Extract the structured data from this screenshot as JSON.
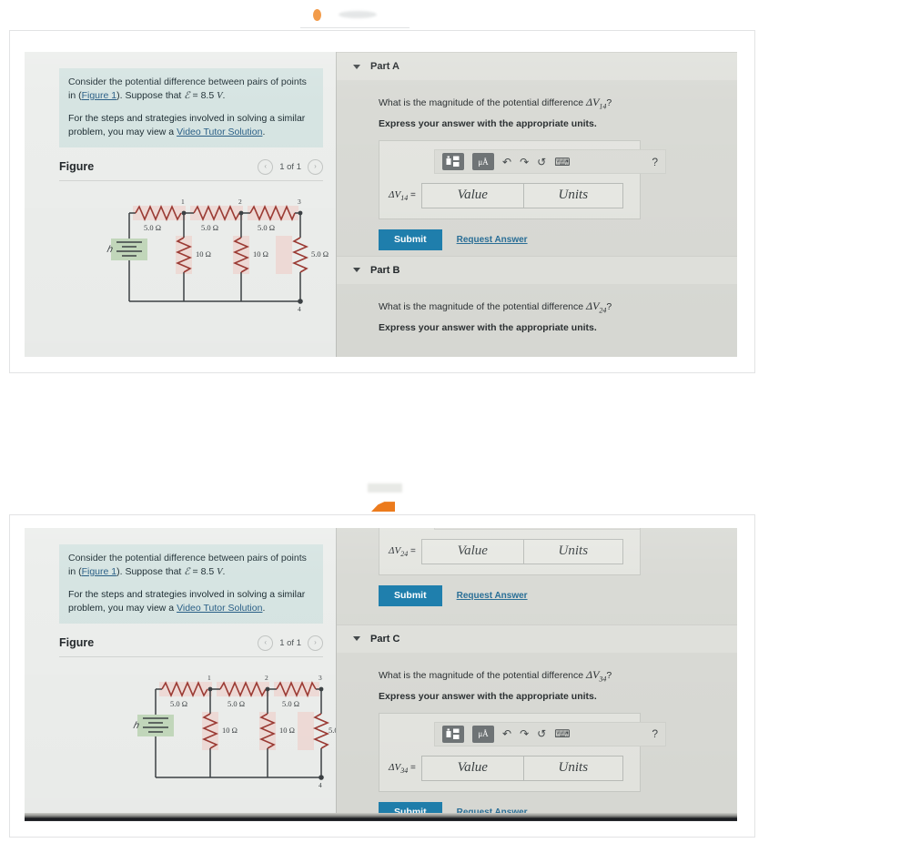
{
  "problem": {
    "para1_a": "Consider the potential difference between pairs of points in (",
    "figure_link": "Figure 1",
    "para1_b": "). Suppose that ",
    "emf_symbol": "ℰ",
    "emf_eq": " = 8.5",
    "emf_unit": "V",
    "para1_c": ".",
    "para2_a": "For the steps and strategies involved in solving a similar problem, you may view a ",
    "video_link": "Video Tutor Solution",
    "para2_b": "."
  },
  "figure": {
    "title": "Figure",
    "prev_icon": "‹",
    "next_icon": "›",
    "counter": "1 of 1"
  },
  "circuit": {
    "emf_label": "ℰ",
    "series_resistors": [
      "5.0 Ω",
      "5.0 Ω",
      "5.0 Ω"
    ],
    "shunt_resistors": [
      "10 Ω",
      "10 Ω",
      "5.0 Ω"
    ],
    "node_labels": [
      "1",
      "2",
      "3",
      "4"
    ]
  },
  "toolbar": {
    "template_icon": "template-icon",
    "units_icon": "μÅ",
    "undo_icon": "↶",
    "redo_icon": "↷",
    "reset_icon": "↺",
    "keyboard_icon": "⌨",
    "help_icon": "?"
  },
  "answer": {
    "value_placeholder": "Value",
    "units_placeholder": "Units",
    "submit_label": "Submit",
    "request_label": "Request Answer"
  },
  "parts": {
    "a": {
      "label": "Part A",
      "question_pre": "What is the magnitude of the potential difference ",
      "symbol": "ΔV",
      "subscript": "14",
      "question_post": "?",
      "instruction": "Express your answer with the appropriate units.",
      "answer_label_symbol": "ΔV",
      "answer_label_sub": "14",
      "answer_label_eq": " ="
    },
    "b": {
      "label": "Part B",
      "question_pre": "What is the magnitude of the potential difference ",
      "symbol": "ΔV",
      "subscript": "24",
      "question_post": "?",
      "instruction": "Express your answer with the appropriate units.",
      "answer_label_symbol": "ΔV",
      "answer_label_sub": "24",
      "answer_label_eq": " ="
    },
    "c": {
      "label": "Part C",
      "question_pre": "What is the magnitude of the potential difference ",
      "symbol": "ΔV",
      "subscript": "34",
      "question_post": "?",
      "instruction": "Express your answer with the appropriate units.",
      "answer_label_symbol": "ΔV",
      "answer_label_sub": "34",
      "answer_label_eq": " ="
    }
  },
  "colors": {
    "accent": "#1f7fad",
    "link": "#2a6f97",
    "prompt_bg": "#d6e4e2",
    "app_bg": "#d9dad5",
    "resistor": "#9c3b34",
    "highlight": "#f3cdc6",
    "battery": "#bcd4b4"
  }
}
